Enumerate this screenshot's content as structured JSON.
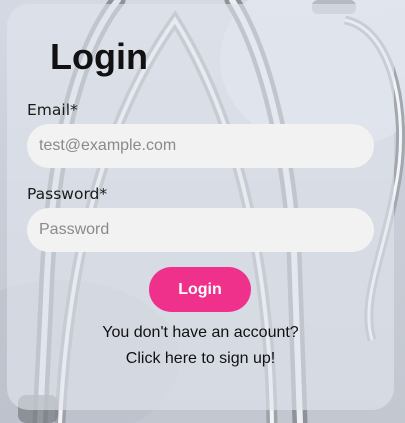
{
  "login_form": {
    "title": "Login",
    "email": {
      "label": "Email*",
      "placeholder": "test@example.com",
      "value": ""
    },
    "password": {
      "label": "Password*",
      "placeholder": "Password",
      "value": ""
    },
    "submit_label": "Login",
    "signup_prompt": "You don't have an account?",
    "signup_link": "Click here to sign up!"
  },
  "colors": {
    "accent": "#f0318b",
    "field_background": "#f2f2f2"
  },
  "background": {
    "image": "stethoscope-photo"
  }
}
